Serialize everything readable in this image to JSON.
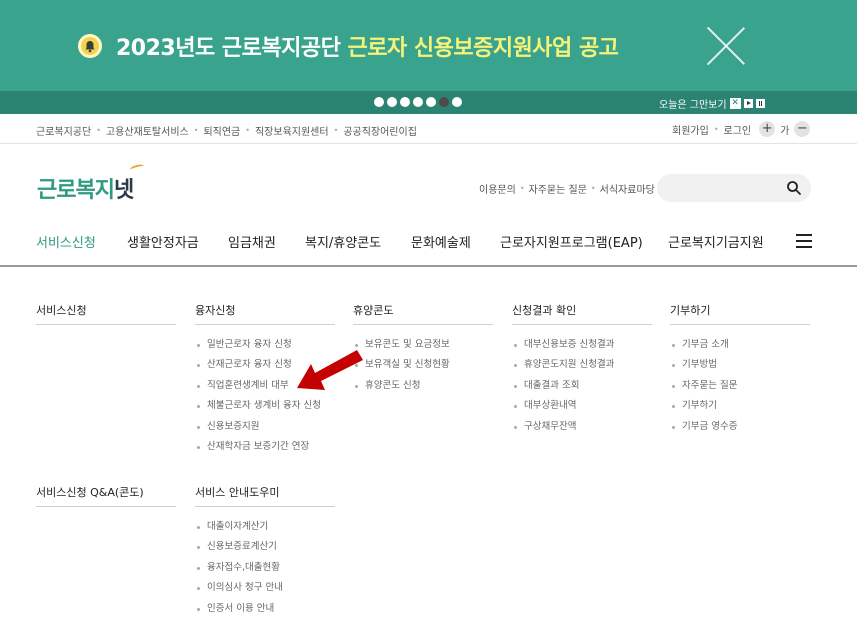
{
  "banner": {
    "title_prefix": "2023년도 근로복지공단 ",
    "title_highlight": "근로자 신용보증지원사업 공고",
    "icon": "bell-icon",
    "dots_total": 7,
    "dots_active_index": 5,
    "today_close_label": "오늘은 그만보기",
    "checkbox_mark": "✕"
  },
  "utility": {
    "links": [
      "근로복지공단",
      "고용산재토탈서비스",
      "퇴직연금",
      "직장보육지원센터",
      "공공직장어린이집"
    ],
    "right_links": [
      "회원가입",
      "로그인"
    ],
    "zoom_in": "+",
    "zoom_label": "가",
    "zoom_out": "−"
  },
  "header": {
    "logo_main": "근로복지",
    "logo_sub": "넷",
    "links": [
      "이용문의",
      "자주묻는 질문",
      "서식자료마당"
    ],
    "search_placeholder": "",
    "search_icon": "search-icon"
  },
  "gnb": {
    "items": [
      "서비스신청",
      "생활안정자금",
      "임금채권",
      "복지/휴양콘도",
      "문화예술제",
      "근로자지원프로그램(EAP)",
      "근로복지기금지원"
    ],
    "active_index": 0,
    "menu_icon": "hamburger-menu-icon"
  },
  "menu": {
    "col1": {
      "title": "서비스신청",
      "items": []
    },
    "col2": {
      "title": "융자신청",
      "items": [
        "일반근로자 융자 신청",
        "산재근로자 융자 신청",
        "직업훈련생계비 대부",
        "체불근로자 생계비 융자 신청",
        "신용보증지원",
        "산재학자금 보증기간 연장"
      ]
    },
    "col3": {
      "title": "휴양콘도",
      "items": [
        "보유콘도 및 요금정보",
        "보유객실 및 신청현황",
        "휴양콘도 신청"
      ]
    },
    "col4": {
      "title": "신청결과 확인",
      "items": [
        "대부신용보증 신청결과",
        "휴양콘도지원 신청결과",
        "대출결과 조회",
        "대부상환내역",
        "구상채무잔액"
      ]
    },
    "col5": {
      "title": "기부하기",
      "items": [
        "기부금 소개",
        "기부방법",
        "자주묻는 질문",
        "기부하기",
        "기부금 영수증"
      ]
    },
    "col6": {
      "title": "서비스신청 Q&A(콘도)",
      "items": []
    },
    "col7": {
      "title": "서비스 안내도우미",
      "items": [
        "대출이자계산기",
        "신용보증료계산기",
        "융자접수,대출현황",
        "이의심사 청구 안내",
        "인증서 이용 안내"
      ]
    }
  },
  "colors": {
    "banner_bg": "#3aa38d",
    "banner_bar": "#2b8371",
    "highlight": "#f6f37a",
    "brand": "#2f9a82",
    "arrow": "#c40000"
  }
}
